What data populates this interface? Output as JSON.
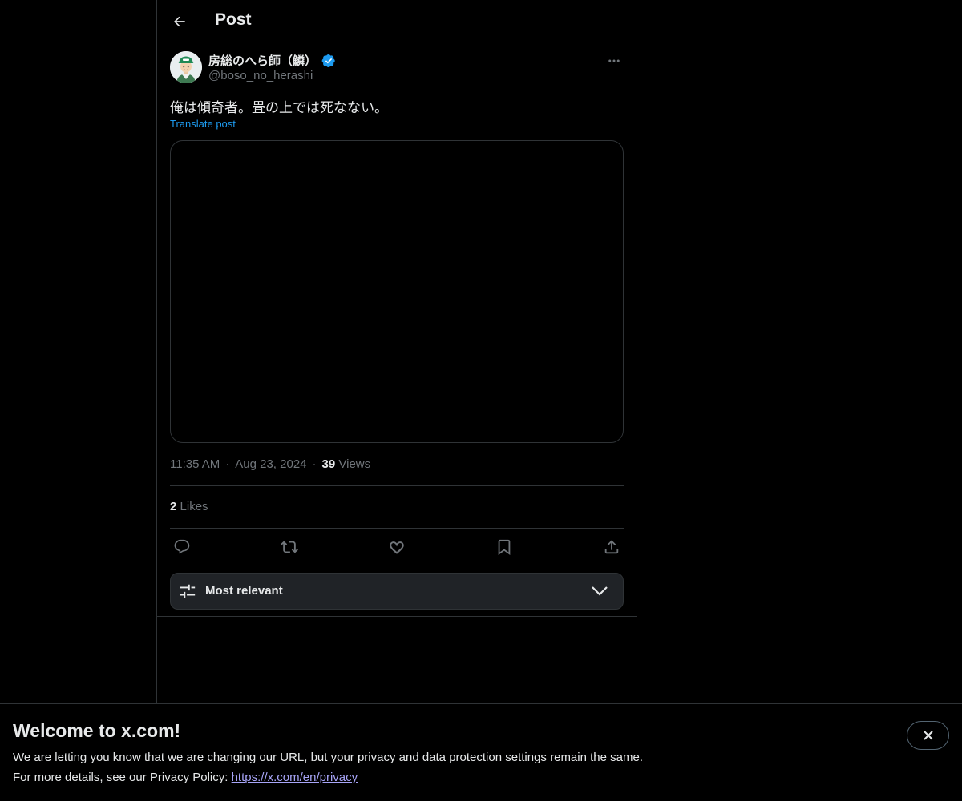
{
  "header": {
    "title": "Post",
    "back_icon": "arrow-left-icon"
  },
  "post": {
    "author": {
      "display_name": "房総のへら師（鱗）",
      "handle": "@boso_no_herashi",
      "verified": true,
      "verified_color": "#1d9bf0"
    },
    "text": "俺は傾奇者。畳の上では死なない。",
    "translate_label": "Translate post",
    "time": "11:35 AM",
    "separator": "·",
    "date": "Aug 23, 2024",
    "views_count": "39",
    "views_label": "Views",
    "likes_count": "2",
    "likes_label": "Likes",
    "actions": [
      "reply-icon",
      "repost-icon",
      "like-icon",
      "bookmark-icon",
      "share-icon"
    ]
  },
  "sort": {
    "label": "Most relevant",
    "icon": "sliders-icon"
  },
  "banner": {
    "title": "Welcome to x.com!",
    "line1": "We are letting you know that we are changing our URL, but your privacy and data protection settings remain the same.",
    "line2_prefix": "For more details, see our Privacy Policy: ",
    "link": "https://x.com/en/privacy",
    "link_color": "#a7a4f7"
  },
  "colors": {
    "background": "#000000",
    "text": "#e7e9ea",
    "muted": "#71767b",
    "accent": "#1d9bf0",
    "border": "#2f3336"
  }
}
